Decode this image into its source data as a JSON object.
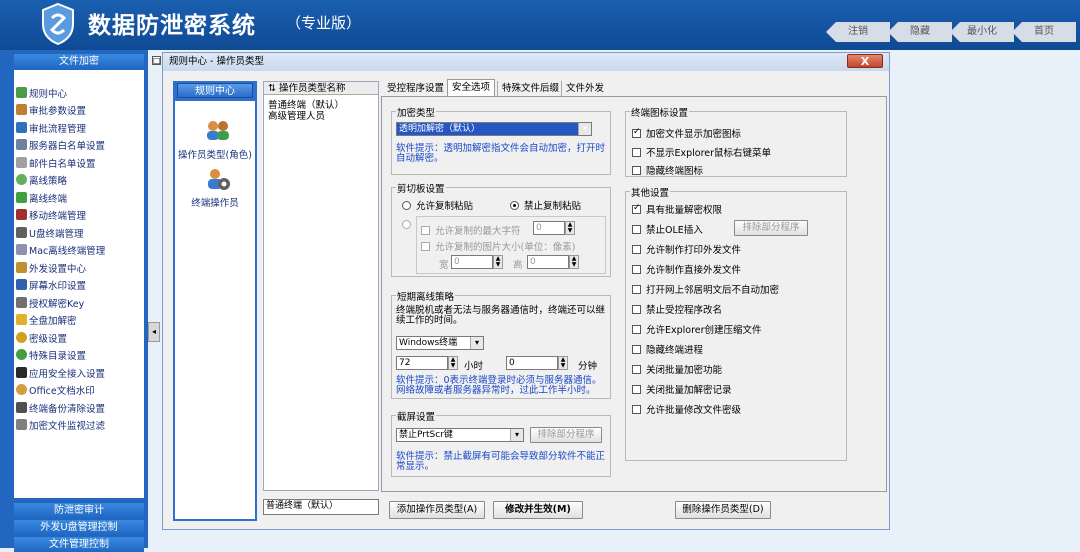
{
  "header": {
    "title": "数据防泄密系统",
    "edition": "（专业版）",
    "nav": [
      "注销",
      "隐藏",
      "最小化",
      "首页"
    ]
  },
  "sidebar": {
    "section1": "文件加密",
    "items": [
      "规则中心",
      "审批参数设置",
      "审批流程管理",
      "服务器白名单设置",
      "邮件白名单设置",
      "离线策略",
      "离线终端",
      "移动终端管理",
      "U盘终端管理",
      "Mac离线终端管理",
      "外发设置中心",
      "屏幕水印设置",
      "授权解密Key",
      "全盘加解密",
      "密级设置",
      "特殊目录设置",
      "应用安全接入设置",
      "Office文档水印",
      "终端备份清除设置",
      "加密文件监视过滤"
    ],
    "bottom": [
      "防泄密审计",
      "外发U盘管理控制",
      "文件管理控制"
    ]
  },
  "window": {
    "title": "规则中心 - 操作员类型",
    "close": "X",
    "nav_header": "规则中心",
    "nav_items": [
      "操作员类型(角色)",
      "终端操作员"
    ],
    "list_header": "操作员类型名称",
    "list_items": [
      "普通终端（默认）",
      "高级管理人员"
    ],
    "name_value": "普通终端（默认）",
    "tabs": [
      "受控程序设置",
      "安全选项",
      "特殊文件后缀",
      "文件外发"
    ],
    "encrypt": {
      "title": "加密类型",
      "selected": "透明加解密（默认）",
      "hint": "软件提示：透明加解密指文件会自动加密，打开时自动解密。"
    },
    "clipboard": {
      "title": "剪切板设置",
      "radio_allow": "允许复制粘贴",
      "radio_deny": "禁止复制粘贴",
      "max_chars": "允许复制的最大字符",
      "max_chars_val": "0",
      "img_size": "允许复制的图片大小(单位：像素)",
      "width_lbl": "宽",
      "width_val": "0",
      "height_lbl": "高",
      "height_val": "0"
    },
    "offline": {
      "title": "短期离线策略",
      "desc": "终端脱机或者无法与服务器通信时，终端还可以继续工作的时间。",
      "mode": "Windows终端",
      "hours": "72",
      "hours_lbl": "小时",
      "minutes": "0",
      "minutes_lbl": "分钟",
      "hint": "软件提示：0表示终端登录时必须与服务器通信。网络故障或者服务器异常时，过此工作半小时。"
    },
    "screenshot": {
      "title": "截屏设置",
      "selected": "禁止PrtScr键",
      "exclude_btn": "排除部分程序",
      "hint": "软件提示：禁止截屏有可能会导致部分软件不能正常显示。"
    },
    "icon_settings": {
      "title": "终端图标设置",
      "items": [
        {
          "label": "加密文件显示加密图标",
          "checked": true
        },
        {
          "label": "不显示Explorer鼠标右键菜单",
          "checked": false
        },
        {
          "label": "隐藏终端图标",
          "checked": false
        }
      ]
    },
    "other": {
      "title": "其他设置",
      "exclude_btn": "排除部分程序",
      "items": [
        {
          "label": "具有批量解密权限",
          "checked": true
        },
        {
          "label": "禁止OLE插入",
          "checked": false
        },
        {
          "label": "允许制作打印外发文件",
          "checked": false
        },
        {
          "label": "允许制作直接外发文件",
          "checked": false
        },
        {
          "label": "打开网上邻居明文后不自动加密",
          "checked": false
        },
        {
          "label": "禁止受控程序改名",
          "checked": false
        },
        {
          "label": "允许Explorer创建压缩文件",
          "checked": false
        },
        {
          "label": "隐藏终端进程",
          "checked": false
        },
        {
          "label": "关闭批量加密功能",
          "checked": false
        },
        {
          "label": "关闭批量加解密记录",
          "checked": false
        },
        {
          "label": "允许批量修改文件密级",
          "checked": false
        }
      ]
    },
    "buttons": {
      "add": "添加操作员类型(A)",
      "modify": "修改并生效(M)",
      "delete": "删除操作员类型(D)"
    }
  },
  "colors": {
    "header": "#1b5fb0",
    "sidebar": "#2266c0",
    "hint": "#1a47c8"
  }
}
